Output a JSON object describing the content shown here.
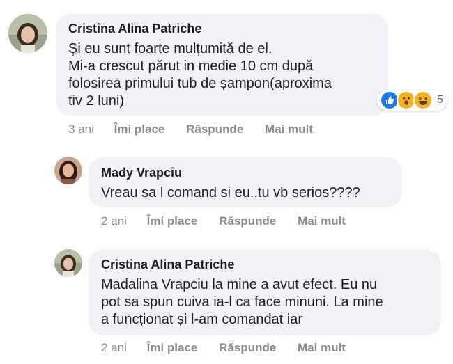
{
  "comments": [
    {
      "author": "Cristina Alina Patriche",
      "text": "Și eu sunt foarte mulțumită de el.\nMi-a crescut părut in medie 10 cm după\nfolosirea primului tub de șampon(aproxima\ntiv 2 luni)",
      "time": "3 ani",
      "like": "Îmi place",
      "reply": "Răspunde",
      "more": "Mai mult",
      "reactions": {
        "count": "5",
        "icons": [
          "like-icon",
          "wow-icon",
          "haha-icon"
        ]
      }
    },
    {
      "author": "Mady Vrapciu",
      "text": "Vreau sa l comand si eu..tu vb serios????",
      "time": "2 ani",
      "like": "Îmi place",
      "reply": "Răspunde",
      "more": "Mai mult"
    },
    {
      "author": "Cristina Alina Patriche",
      "text": "Madalina Vrapciu la mine a avut efect. Eu nu\npot sa spun cuiva ia-l ca face minuni. La mine\na funcționat și l-am comandat iar",
      "time": "2 ani",
      "like": "Îmi place",
      "reply": "Răspunde",
      "more": "Mai mult"
    }
  ],
  "colors": {
    "bubble": "#f0f2f5",
    "action_text": "#8a8d91",
    "like_blue": "#1877f2",
    "wow_yellow": "#f7b125"
  }
}
